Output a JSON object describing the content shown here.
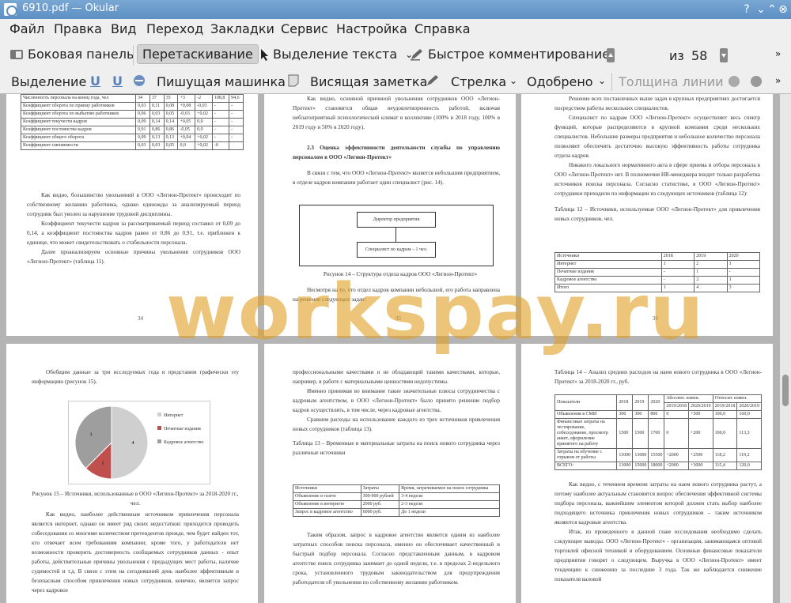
{
  "window": {
    "title": "6910.pdf  — Okular"
  },
  "menu": [
    "Файл",
    "Правка",
    "Вид",
    "Переход",
    "Закладки",
    "Сервис",
    "Настройка",
    "Справка"
  ],
  "toolbar": {
    "sidebar": "Боковая панель",
    "drag": "Перетаскивание",
    "text_select": "Выделение текста",
    "quick_comment": "Быстрое комментирование",
    "page_current": "38",
    "page_of": "из",
    "page_total": "58"
  },
  "annot": {
    "highlight": "Выделение",
    "typewriter": "Пишущая машинка",
    "sticky": "Висящая заметка",
    "arrow": "Стрелка",
    "approved": "Одобрено",
    "line_width": "Толщина линии"
  },
  "watermark": "workspay.ru",
  "pages": {
    "p34": {
      "table_rows": [
        [
          "Численность персонала на конец года, чел",
          "34",
          "37",
          "35",
          "+3",
          "-2",
          "108,8",
          "94,6"
        ],
        [
          "Коэффициент оборота по приему работников",
          "0,03",
          "0,11",
          "0,08",
          "+0,08",
          "-0,03",
          "-",
          "-"
        ],
        [
          "Коэффициент оборота по выбытию работников",
          "0,06",
          "0,03",
          "0,05",
          "-0,03",
          "+0,02",
          "-",
          "-"
        ],
        [
          "Коэффициент текучести кадров",
          "0,09",
          "0,14",
          "0,14",
          "+0,05",
          "0,0",
          "-",
          "-"
        ],
        [
          "Коэффициент постоянства кадров",
          "0,91",
          "0,86",
          "0,86",
          "-0,05",
          "0,0",
          "-",
          "-"
        ],
        [
          "Коэффициент общего оборота",
          "0,09",
          "0,13",
          "0,13",
          "+0,04",
          "+0,02",
          "-",
          "-"
        ],
        [
          "Коэффициент сменяемости",
          "0,03",
          "0,03",
          "0,05",
          "0,0",
          "+0,02",
          "-0",
          ""
        ]
      ],
      "p1": "Как видно, большинство увольнений в ООО «Легион-Протект» происходит по собственному желанию работника, однако единожды за анализируемый период сотрудник был уволен за нарушение трудовой дисциплины.",
      "p2": "Коэффициент текучести кадров за рассматриваемый период составил от 0,09 до 0,14, а коэффициент постоянства кадров равен от 0,86 до 0,91, т.е. приближен к единице, что может свидетельствовать о стабильности персонала.",
      "p3": "Далее проанализируем основные причины увольнения сотрудников ООО «Легион-Протект» (таблица 11).",
      "num": "34"
    },
    "p35": {
      "p0": "Как видно, основной причиной увольнения сотрудников ООО «Легион-Протект» становится общая неудовлетворенность работой, включая неблагоприятный психологический климат в коллективе (100% в 2018 году, 100% в 2019 году и 50% в 2020 году).",
      "heading": "2.3 Оценка эффективности деятельности службы по управлению персоналом в ООО «Легион-Протект»",
      "p1": "В связи с тем, что ООО «Легион-Протект» является небольшим предприятием, в отделе кадров компании работает один специалист (рис. 14).",
      "box1": "Директор предприятия",
      "box2": "Специалист по кадрам – 1 чел.",
      "caption": "Рисунок 14 – Структура отдела кадров ООО «Легион-Протект»",
      "p2": "Несмотря на то, что отдел кадров компании небольшой, его работа направлена на решение следующих задач:",
      "num": "35"
    },
    "p36": {
      "p1": "Решение всех поставленных выше задач в крупных предприятиях достигается посредством работы нескольких специалистов.",
      "p2": "Специалист по кадрам ООО «Легион-Протект» осуществляет весь спектр функций, которые распределяются в крупной компании среди нескольких специалистов. Небольшие размеры предприятия и небольшое количество персонала позволяют обеспечить достаточно высокую эффективность работы сотрудника отдела кадров.",
      "p3": "Никакого локального нормативного акта в сфере приема и отбора персонала в ООО «Легион-Протект» нет. В полномочия HR-менеджера входит только разработка источников поиска персонала. Согласно статистике, в ООО «Легион-Протект» сотрудники приходили по информации из следующих источников (таблица 12):",
      "tcap": "Таблица 12 – Источники, используемые ООО «Легион-Протект» для привлечения новых сотрудников, чел.",
      "thead": [
        "Источники",
        "2018",
        "2019",
        "2020"
      ],
      "trows": [
        [
          "Интернет",
          "1",
          "2",
          "1"
        ],
        [
          "Печатные издания",
          "-",
          "1",
          "-"
        ],
        [
          "Кадровое агентство",
          "-",
          "2",
          "1"
        ],
        [
          "Итого",
          "1",
          "4",
          "3"
        ]
      ],
      "num": "36"
    },
    "p37": {
      "p1": "Обобщим данные за три исследуемых года и представим графически эту информацию (рисунок 15).",
      "legend": [
        "Интернет",
        "Печатные издания",
        "Кадровое агентство"
      ],
      "slices": [
        4,
        1,
        3
      ],
      "slice_labels": [
        "4",
        "1",
        "3"
      ],
      "caption": "Рисунок 15 – Источники, использованные в ООО «Легион-Протект» за 2018-2020 гг., чел.",
      "p2": "Как видно, наиболее действенным источником привлечения персонала является интернет, однако он имеет ряд своих недостатков: приходится проводить собеседования со многими количеством претендентов прежде, чем будет найден тот, кто отвечает всем требованиям компании; кроме того, у работодателя нет возможности проверить достоверность сообщаемых сотрудников данных - опыт работы, действительные причины увольнения с предыдущих мест работы, наличие судимостей и т.д. В связи с этим на сегодняшний день наиболее эффективным и безопасным способом привлечения новых сотрудников, конечно, является запрос через кадровое"
    },
    "p38": {
      "p1": "профессиональными качествами и не обладающий такими качествами, которые, например, в работе с материальными ценностями недопустимы.",
      "p2": "Именно принимая во внимание такие значительные плюсы сотрудничества с кадровым агентством, в ООО «Легион-Протект» было принято решение подбор кадров осуществлять, в том числе, через кадровые агентства.",
      "p3": "Сравним расходы на использование каждого из трех источников привлечения новых сотрудников (таблица 13).",
      "tcap": "Таблица 13 – Временные и материальные затраты на поиск нового сотрудника через различные источники",
      "thead": [
        "Источники",
        "Затраты",
        "Время, затрачиваемое на поиск сотрудника"
      ],
      "trows": [
        [
          "Объявление в газете",
          "300-900 рублей",
          "3-4 недели"
        ],
        [
          "Объявление в интернете",
          "2000 руб.",
          "2-3 недели"
        ],
        [
          "Запрос в кадровое агентство",
          "6000 руб.",
          "До 1 недели"
        ]
      ],
      "p4": "Таким образом, запрос в кадровое агентство является одним из наиболее затратных способов поиска персонала, именно он обеспечивает качественный и быстрый подбор персонала. Согласно представленным данным, в кадровом агентстве поиск сотрудника занимает до одной недели, т.е. в пределах 2-недельного срока, установленного трудовым законодательством для предупреждения работодателя об увольнении по собственному желанию работником."
    },
    "p39": {
      "tcap": "Таблица 14 – Анализ средних расходов на наем нового сотрудника в ООО «Легион-Протект» за 2018-2020 гг., руб.",
      "thead": [
        "Показатели",
        "2018",
        "2019",
        "2020",
        "Абсолют. измен.",
        "Относит. измен."
      ],
      "thead2": [
        "2019/2018",
        "2020/2019",
        "2019/2018",
        "2020/2019"
      ],
      "trows": [
        [
          "Объявления в СМИ",
          "300",
          "300",
          "800",
          "0",
          "+500",
          "100,0",
          "160,0"
        ],
        [
          "Финансовые затраты на тестирование, собеседование, просмотр анкет, оформление принятого на работу",
          "1500",
          "1500",
          "1700",
          "0",
          "+200",
          "100,0",
          "113,3"
        ],
        [
          "Затраты на обучение с отрывом от работы",
          "11000",
          "13000",
          "15500",
          "+2000",
          "+2500",
          "118,2",
          "119,2"
        ],
        [
          "ВСЕГО:",
          "13000",
          "15000",
          "18000",
          "+2000",
          "+3000",
          "115,4",
          "120,0"
        ]
      ],
      "p1": "Как видно, с течением времени затраты на наем нового сотрудника растут, а потому наиболее актуальным становится вопрос обеспечения эффективной системы подбора персонала, важнейшим элементом которой должен стать выбор наиболее подходящего источника привлечения новых сотрудников – таким источником являются кадровые агентства.",
      "p2": "Итак, из проведенного в данной главе исследования необходимо сделать следующие выводы. ООО «Легион-Протект» - организация, занимающаяся оптовой торговлей офисной техникой и оборудованием. Основные финансовые показатели предприятия говорят о следующем. Выручка в ООО «Легион-Протект» имеет тенденцию к снижению за последние 3 года. Так же наблюдается снижение показателя валовой"
    }
  }
}
